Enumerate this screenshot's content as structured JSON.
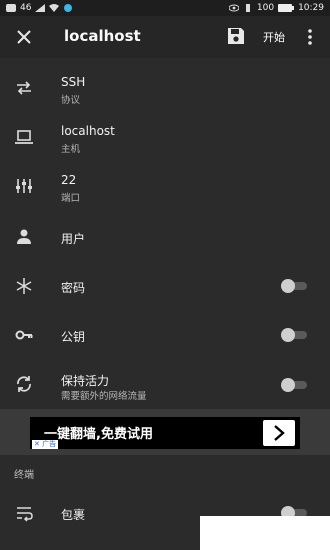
{
  "status_bar": {
    "left_text": "46",
    "right_text": "100",
    "time": "10:29"
  },
  "header": {
    "title": "localhost",
    "start_label": "开始",
    "icons": [
      "close-icon",
      "save-icon",
      "more-vert-icon"
    ]
  },
  "settings": {
    "protocol": {
      "label": "SSH",
      "sub": "协议",
      "icon": "swap-icon"
    },
    "host": {
      "label": "localhost",
      "sub": "主机",
      "icon": "laptop-icon"
    },
    "port": {
      "label": "22",
      "sub": "端口",
      "icon": "sliders-icon"
    },
    "user": {
      "label": "用户",
      "icon": "person-icon"
    },
    "password": {
      "label": "密码",
      "icon": "asterisk-icon",
      "enabled": false
    },
    "pubkey": {
      "label": "公钥",
      "icon": "key-icon",
      "enabled": false
    },
    "keepalive": {
      "label": "保持活力",
      "sub": "需要额外的网络流量",
      "icon": "sync-icon",
      "enabled": false
    }
  },
  "ad": {
    "text": "一键翻墙,免费试用",
    "badge": "广告"
  },
  "terminal_section": {
    "header": "终端",
    "wrap": {
      "label": "包裹",
      "icon": "wrap-icon",
      "enabled": false
    }
  },
  "colors": {
    "background": "#2b2b2b",
    "toggle_track": "#5a5a5a",
    "toggle_knob": "#cfcfcf"
  }
}
